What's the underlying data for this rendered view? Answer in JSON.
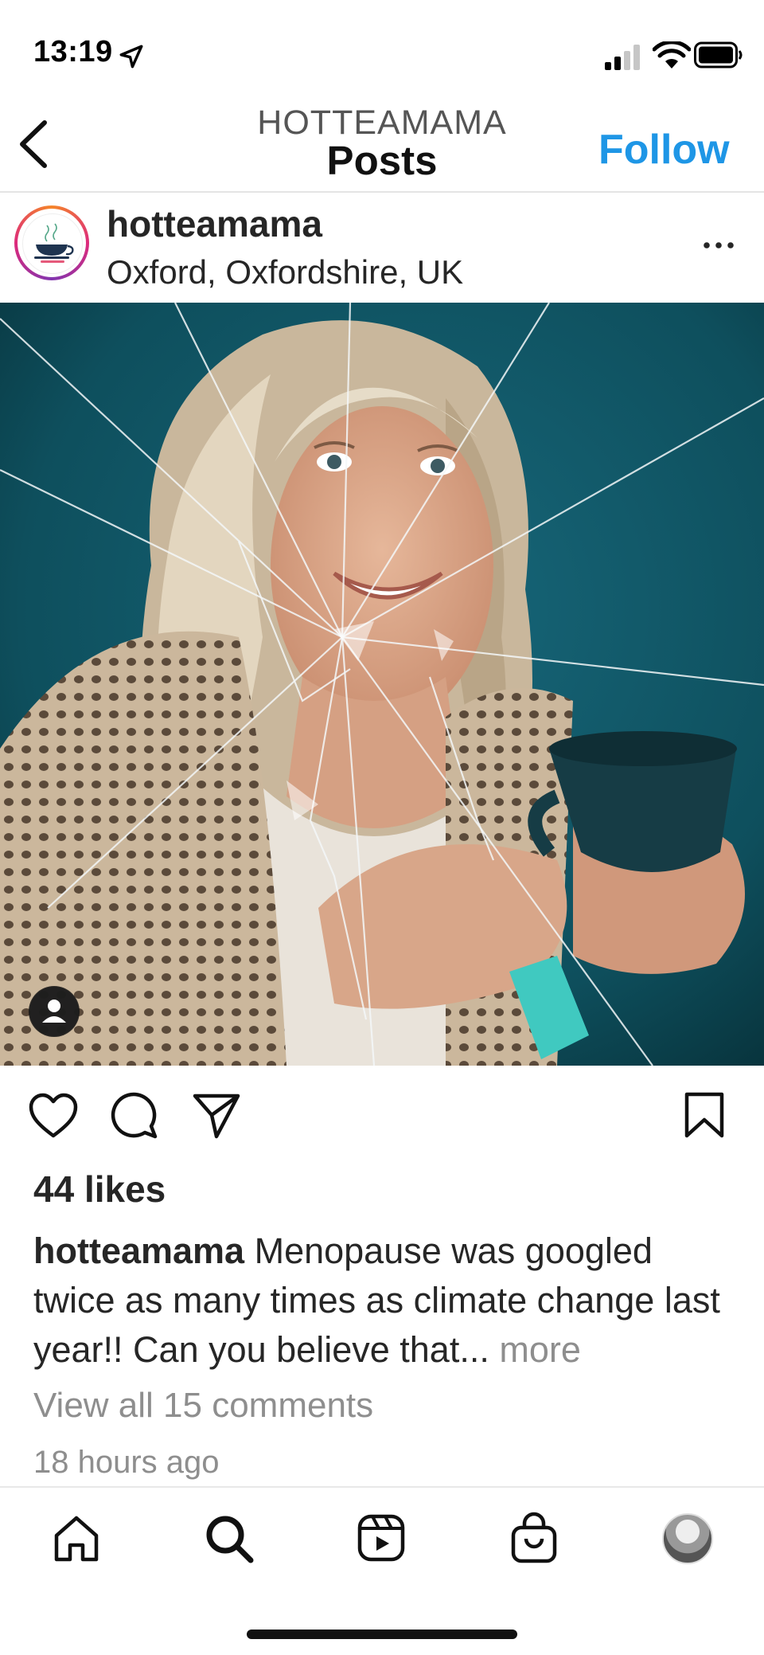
{
  "status_bar": {
    "time": "13:19"
  },
  "header": {
    "username": "HOTTEAMAMA",
    "title": "Posts",
    "follow_label": "Follow"
  },
  "post": {
    "username": "hotteamama",
    "location": "Oxford, Oxfordshire, UK",
    "likes": "44 likes",
    "caption_user": "hotteamama",
    "caption_text": "Menopause was googled twice as many times as climate change last year!! Can you believe that...",
    "caption_more": "more",
    "view_comments": "View all 15 comments",
    "time_ago": "18 hours ago"
  },
  "colors": {
    "accent": "#1e96e6",
    "photo_background": "#0e4f5d",
    "muted_text": "#8e8e8e"
  },
  "icons": {
    "back": "chevron-left-icon",
    "more": "more-horizontal-icon",
    "like": "heart-icon",
    "comment": "comment-bubble-icon",
    "share": "paper-plane-icon",
    "save": "bookmark-icon",
    "tabs": [
      "home-icon",
      "search-icon",
      "reels-icon",
      "shop-bag-icon",
      "profile-avatar"
    ]
  }
}
